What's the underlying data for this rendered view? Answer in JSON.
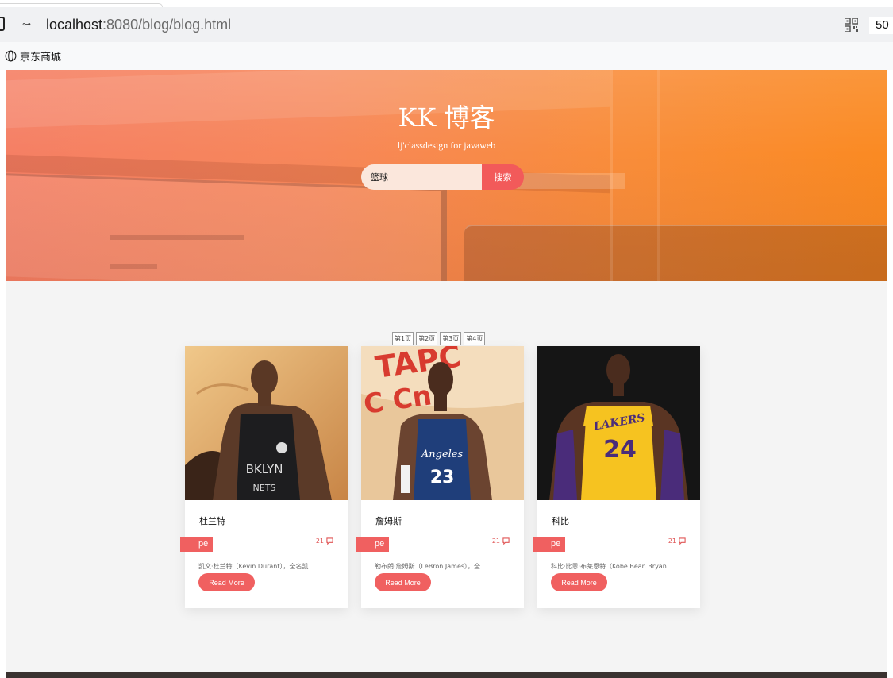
{
  "browser": {
    "url_host": "localhost",
    "url_path": ":8080/blog/blog.html",
    "site_info_icon": "site-info-icon",
    "zoom_text": "50",
    "bookmark_label": "京东商城"
  },
  "hero": {
    "title": "KK 博客",
    "subtitle": "lj'classdesign for javaweb",
    "search_value": "篮球",
    "search_button": "搜索",
    "background_colors": [
      "#f57f64",
      "#fa8a22"
    ]
  },
  "pagination": [
    "第1页",
    "第2页",
    "第3页",
    "第4页"
  ],
  "posts": [
    {
      "name": "杜兰特",
      "tag": "pe",
      "comments": "21",
      "excerpt": "凯文·杜兰特（Kevin Durant），全名凯...",
      "read_more": "Read More",
      "jersey_text": "BKLYN",
      "jersey_sub": "NETS"
    },
    {
      "name": "詹姆斯",
      "tag": "pe",
      "comments": "21",
      "excerpt": "勒布朗·詹姆斯（LeBron James），全...",
      "read_more": "Read More",
      "jersey_text": "Angeles",
      "jersey_sub": "23"
    },
    {
      "name": "科比",
      "tag": "pe",
      "comments": "21",
      "excerpt": "科比·比恩·布莱恩特（Kobe Bean Bryan...",
      "read_more": "Read More",
      "jersey_text": "LAKERS",
      "jersey_sub": "24"
    }
  ],
  "colors": {
    "accent": "#f06060",
    "page_bg": "#f4f4f4",
    "footer": "#3a3230"
  }
}
